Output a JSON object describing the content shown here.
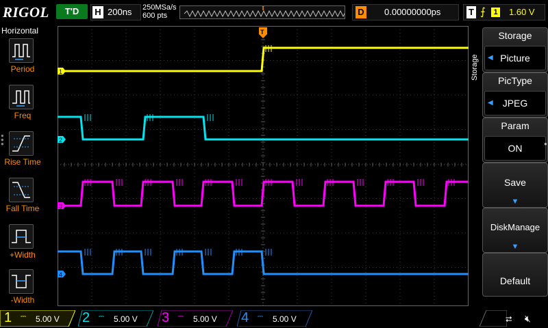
{
  "top": {
    "logo": "RIGOL",
    "run_state": "T'D",
    "h_tag": "H",
    "timebase": "200ns",
    "sample_rate": "250MSa/s",
    "points": "600 pts",
    "delay_tag": "D",
    "delay": "0.00000000ps",
    "trig_tag": "T",
    "trig_source": "1",
    "trig_level": "1.60 V"
  },
  "left": {
    "title": "Horizontal",
    "buttons": [
      {
        "label": "Period",
        "icon": "period-icon"
      },
      {
        "label": "Freq",
        "icon": "freq-icon"
      },
      {
        "label": "Rise Time",
        "icon": "rise-time-icon"
      },
      {
        "label": "Fall Time",
        "icon": "fall-time-icon"
      },
      {
        "label": "+Width",
        "icon": "pos-width-icon"
      },
      {
        "label": "-Width",
        "icon": "neg-width-icon"
      }
    ]
  },
  "right": {
    "side_label": "Storage",
    "storage_title": "Storage",
    "storage_value": "Picture",
    "pictype_title": "PicType",
    "pictype_value": "JPEG",
    "param_title": "Param",
    "param_value": "ON",
    "save_label": "Save",
    "diskmanage_label": "DiskManage",
    "default_label": "Default"
  },
  "channels": [
    {
      "num": "1",
      "scale": "5.00 V",
      "color": "#ffff00"
    },
    {
      "num": "2",
      "scale": "5.00 V",
      "color": "#00e5ee"
    },
    {
      "num": "3",
      "scale": "5.00 V",
      "color": "#ff00ff"
    },
    {
      "num": "4",
      "scale": "5.00 V",
      "color": "#1e90ff"
    }
  ],
  "status": {
    "usb_icon": "usb-icon",
    "speaker_icon": "speaker-muted-icon"
  }
}
